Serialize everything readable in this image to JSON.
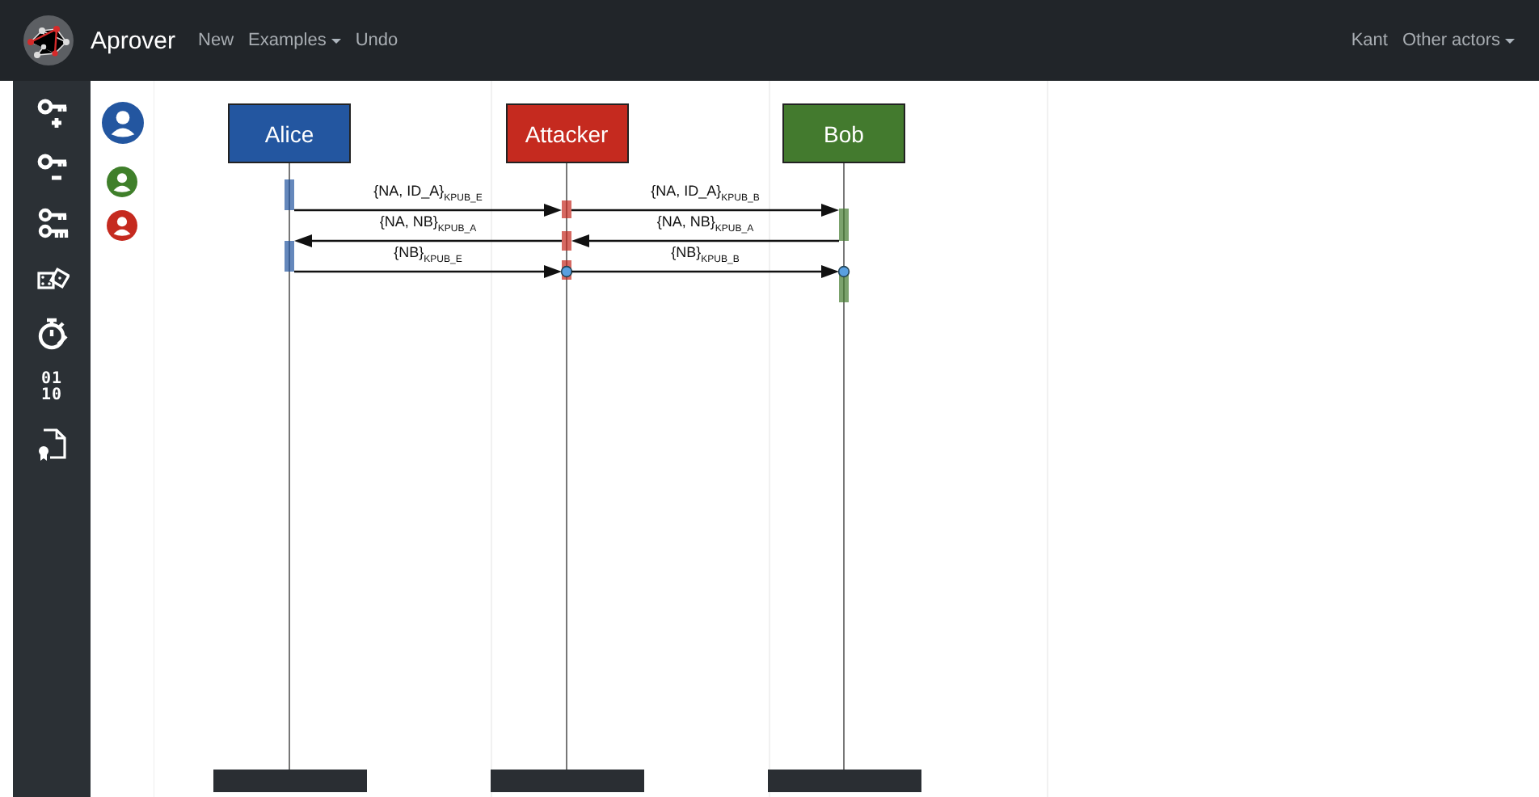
{
  "navbar": {
    "brand": "Aprover",
    "links": [
      {
        "label": "New",
        "dropdown": false
      },
      {
        "label": "Examples",
        "dropdown": true
      },
      {
        "label": "Undo",
        "dropdown": false
      }
    ],
    "right_links": [
      {
        "label": "Kant",
        "dropdown": false
      },
      {
        "label": "Other actors",
        "dropdown": true
      }
    ]
  },
  "sidebar": {
    "items": [
      {
        "kind": "key-add"
      },
      {
        "kind": "key-remove"
      },
      {
        "kind": "keys"
      },
      {
        "kind": "dice"
      },
      {
        "kind": "stopwatch"
      },
      {
        "kind": "text",
        "text": "01\n10"
      },
      {
        "kind": "certificate"
      }
    ]
  },
  "avatars": [
    {
      "color": "#2356a0",
      "selected": true
    },
    {
      "color": "#3f7f2a",
      "selected": false
    },
    {
      "color": "#c52a1f",
      "selected": false
    }
  ],
  "diagram": {
    "actors": [
      {
        "name": "Alice",
        "color": "#2356a0"
      },
      {
        "name": "Attacker",
        "color": "#c52a1f"
      },
      {
        "name": "Bob",
        "color": "#437a2e"
      }
    ],
    "message_rows": [
      {
        "messages": [
          {
            "kind": "rightward",
            "label": "{NA, ID_A}$_{KPUB_E}$",
            "end_dot": false
          },
          {
            "kind": "rightward",
            "label": "{NA, ID_A}$_{KPUB_B}$",
            "end_dot": false
          }
        ]
      },
      {
        "messages": [
          {
            "kind": "leftward",
            "label": "{NA, NB}$_{KPUB_A}$",
            "end_dot": false
          },
          {
            "kind": "leftward",
            "label": "{NA, NB}$_{KPUB_A}$",
            "end_dot": false
          }
        ]
      },
      {
        "messages": [
          {
            "kind": "rightward",
            "label": "{NB}$_{KPUB_E}$",
            "end_dot": true
          },
          {
            "kind": "rightward",
            "label": "{NB}$_{KPUB_B}$",
            "end_dot": true
          }
        ]
      }
    ]
  }
}
